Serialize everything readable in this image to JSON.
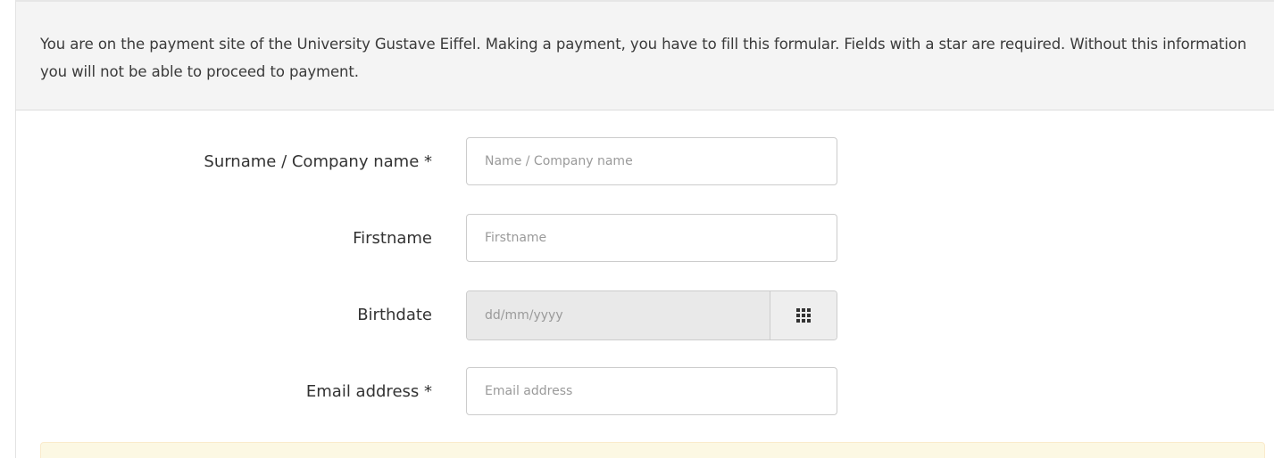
{
  "notice": {
    "text": "You are on the payment site of the University Gustave Eiffel. Making a payment, you have to fill this formular. Fields with a star are required. Without this information you will not be able to proceed to payment."
  },
  "form": {
    "surname": {
      "label": "Surname / Company name *",
      "placeholder": "Name / Company name",
      "value": ""
    },
    "firstname": {
      "label": "Firstname",
      "placeholder": "Firstname",
      "value": ""
    },
    "birthdate": {
      "label": "Birthdate",
      "placeholder": "dd/mm/yyyy",
      "value": "",
      "icon": "calendar-grid-icon"
    },
    "email": {
      "label": "Email address *",
      "placeholder": "Email address",
      "value": ""
    }
  },
  "colors": {
    "notice_bg": "#f4f4f4",
    "warning_bg": "#fcf8e3",
    "warning_border": "#faebcc",
    "input_border": "#cccccc",
    "disabled_bg": "#e9e9e9"
  }
}
